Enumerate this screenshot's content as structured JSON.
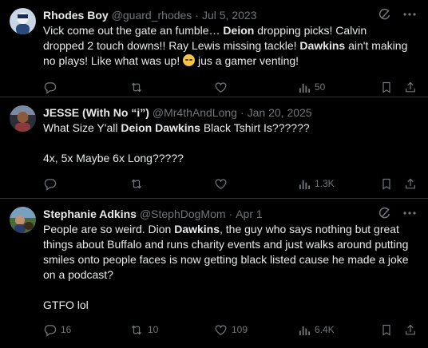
{
  "tweets": [
    {
      "name": "Rhodes Boy",
      "handle": "@guard_rhodes",
      "dot": "·",
      "date": "Jul 5, 2023",
      "avatar_color": "#c8d6e6",
      "text": {
        "s1": "Vick come out the gate an fumble…  ",
        "b1": "Deion",
        "s2": " dropping picks! Calvin dropped 2 touch downs!! Ray Lewis missing tackle! ",
        "b2": "Dawkins",
        "s3": " ain't making no plays! Like what was up! ",
        "s4": " jus a gamer venting!"
      },
      "stats": {
        "replies": "",
        "retweets": "",
        "likes": "",
        "views": "50"
      }
    },
    {
      "name": "JESSE (With No “i”)",
      "handle": "@Mr4thAndLong",
      "dot": "·",
      "date": "Jan 20, 2025",
      "avatar_color": "#8a3a3a",
      "text": {
        "s1": "What Size Y'all ",
        "b1": "Deion Dawkins",
        "s2": " Black Tshirt Is??????",
        "s3": "4x, 5x Maybe 6x Long?????"
      },
      "stats": {
        "replies": "",
        "retweets": "",
        "likes": "",
        "views": "1.3K"
      }
    },
    {
      "name": "Stephanie Adkins",
      "handle": "@StephDogMom",
      "dot": "·",
      "date": "Apr 1",
      "avatar_color": "#4a7a3a",
      "text": {
        "s1": "People are so weird. Dion ",
        "b1": "Dawkins",
        "s2": ", the guy who says nothing but great things about Buffalo and runs charity events and just walks around putting smiles onto people faces is now getting black listed cause he made a joke on a podcast?",
        "s3": "GTFO lol"
      },
      "stats": {
        "replies": "16",
        "retweets": "10",
        "likes": "109",
        "views": "6.4K"
      }
    }
  ],
  "icons": {
    "grok": "grok-icon",
    "more": "more-icon",
    "reply": "reply-icon",
    "retweet": "retweet-icon",
    "like": "like-icon",
    "views": "views-icon",
    "bookmark": "bookmark-icon",
    "share": "share-icon"
  },
  "colors": {
    "background": "#000000",
    "text": "#e7e9ea",
    "muted": "#71767b",
    "divider": "#2f3336"
  }
}
